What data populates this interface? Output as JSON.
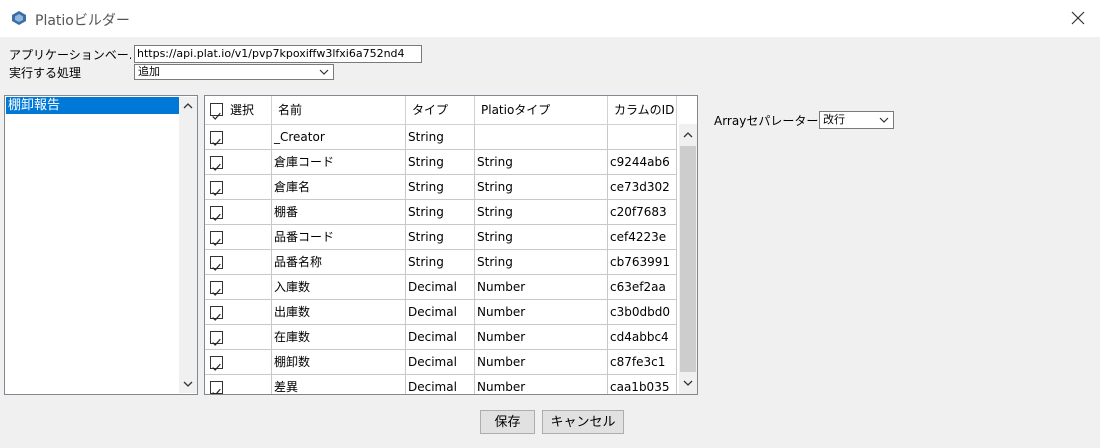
{
  "window": {
    "title": "Platioビルダー"
  },
  "form": {
    "app_base_label": "アプリケーションベー...",
    "app_base_value": "https://api.plat.io/v1/pvp7kpoxiffw3lfxi6a752nd4",
    "action_label": "実行する処理",
    "action_value": "追加"
  },
  "sidebar": {
    "items": [
      "棚卸報告"
    ]
  },
  "table": {
    "headers": [
      "選択",
      "名前",
      "タイプ",
      "Platioタイプ",
      "カラムのID"
    ],
    "rows": [
      {
        "checked": true,
        "name": "_Creator",
        "type": "String",
        "platio_type": "",
        "column_id": ""
      },
      {
        "checked": true,
        "name": "倉庫コード",
        "type": "String",
        "platio_type": "String",
        "column_id": "c9244ab6"
      },
      {
        "checked": true,
        "name": "倉庫名",
        "type": "String",
        "platio_type": "String",
        "column_id": "ce73d302"
      },
      {
        "checked": true,
        "name": "棚番",
        "type": "String",
        "platio_type": "String",
        "column_id": "c20f7683"
      },
      {
        "checked": true,
        "name": "品番コード",
        "type": "String",
        "platio_type": "String",
        "column_id": "cef4223e"
      },
      {
        "checked": true,
        "name": "品番名称",
        "type": "String",
        "platio_type": "String",
        "column_id": "cb763991"
      },
      {
        "checked": true,
        "name": "入庫数",
        "type": "Decimal",
        "platio_type": "Number",
        "column_id": "c63ef2aa"
      },
      {
        "checked": true,
        "name": "出庫数",
        "type": "Decimal",
        "platio_type": "Number",
        "column_id": "c3b0dbd0"
      },
      {
        "checked": true,
        "name": "在庫数",
        "type": "Decimal",
        "platio_type": "Number",
        "column_id": "cd4abbc4"
      },
      {
        "checked": true,
        "name": "棚卸数",
        "type": "Decimal",
        "platio_type": "Number",
        "column_id": "c87fe3c1"
      },
      {
        "checked": true,
        "name": "差異",
        "type": "Decimal",
        "platio_type": "Number",
        "column_id": "caa1b035"
      }
    ]
  },
  "array_separator": {
    "label": "Arrayセパレーター",
    "value": "改行"
  },
  "buttons": {
    "save": "保存",
    "cancel": "キャンセル"
  },
  "colors": {
    "selection": "#0078d7",
    "window_bg": "#f0f0f0"
  }
}
